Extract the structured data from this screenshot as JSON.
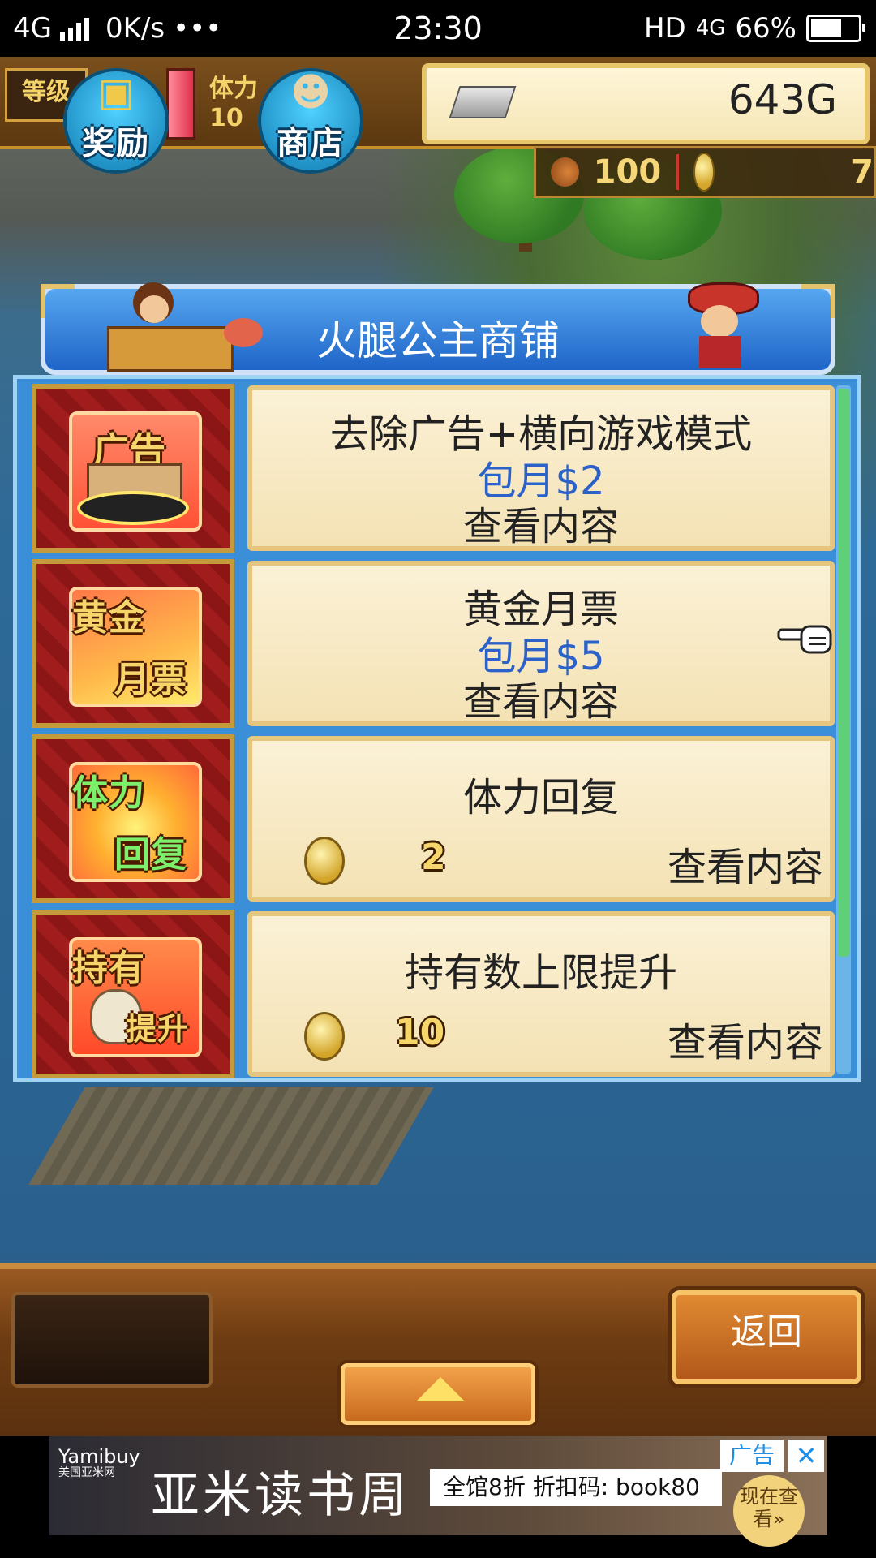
{
  "status_bar": {
    "network": "4G",
    "speed": "0K/s",
    "more": "•••",
    "time": "23:30",
    "hd": "HD",
    "network_right": "4G",
    "battery": "66%",
    "battery_level": 0.66
  },
  "hud": {
    "level_label": "等级",
    "hp_label": "体力",
    "hp_value": "10",
    "reward_label": "奖励",
    "shop_label": "商店",
    "gold": "643G",
    "food": "100",
    "coins": "7"
  },
  "shop": {
    "title": "火腿公主商铺",
    "items": [
      {
        "icon_top": "广告",
        "name": "去除广告+横向游戏模式",
        "price": "包月$2",
        "view": "查看内容"
      },
      {
        "icon_top": "黄金",
        "icon_bottom": "月票",
        "name": "黄金月票",
        "price": "包月$5",
        "view": "查看内容"
      },
      {
        "icon_top": "体力",
        "icon_bottom": "回复",
        "name": "体力回复",
        "cost": "2",
        "view": "查看内容"
      },
      {
        "icon_top": "持有",
        "icon_bottom": "提升",
        "name": "持有数上限提升",
        "cost": "10",
        "view": "查看内容"
      }
    ]
  },
  "bottom": {
    "back_label": "返回"
  },
  "ad": {
    "brand": "Yamibuy",
    "brand_sub": "美国亚米网",
    "title": "亚米读书周",
    "promo": "全馆8折 折扣码: book80",
    "label": "广告",
    "close": "✕",
    "cta": "现在查看»"
  },
  "colors": {
    "accent_blue": "#2a62c9",
    "panel_blue": "#1f64c8",
    "card_cream": "#f4e2b4",
    "wood": "#6e3c12"
  }
}
